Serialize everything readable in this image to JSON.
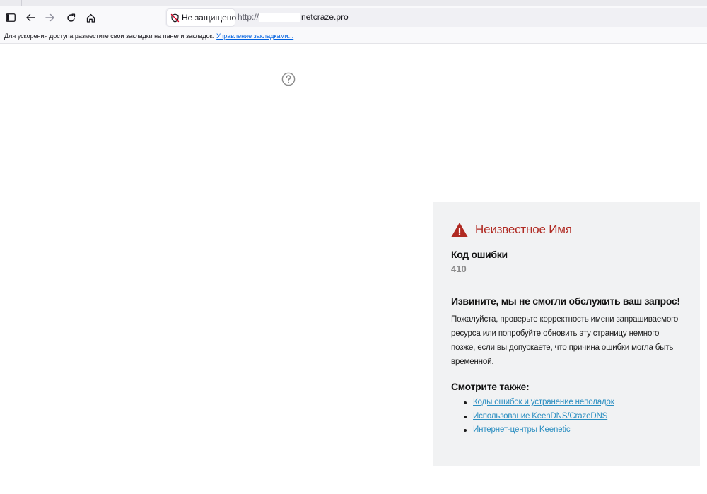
{
  "browser": {
    "security_label": "Не защищено",
    "url_prefix": "http://",
    "url_domain": "netcraze.pro",
    "bookmarks_message": "Для ускорения доступа разместите свои закладки на панели закладок.",
    "bookmarks_link": "Управление закладками..."
  },
  "error": {
    "title": "Неизвестное Имя",
    "code_label": "Код ошибки",
    "code_value": "410",
    "sorry_title": "Извините, мы не смогли обслужить ваш запрос!",
    "sorry_text": "Пожалуйста, проверьте корректность имени запрашиваемого ресурса или попробуйте обновить эту страницу немного позже, если вы допускаете, что причина ошибки могла быть временной.",
    "see_also_title": "Смотрите также:",
    "links": [
      {
        "label": "Коды ошибок и устранение неполадок"
      },
      {
        "label": "Использование KeenDNS/CrazeDNS"
      },
      {
        "label": "Интернет-центры Keenetic"
      }
    ]
  },
  "colors": {
    "error_red": "#b02a22",
    "link_blue": "#2a8ec1",
    "card_bg": "#f1f2f3"
  }
}
